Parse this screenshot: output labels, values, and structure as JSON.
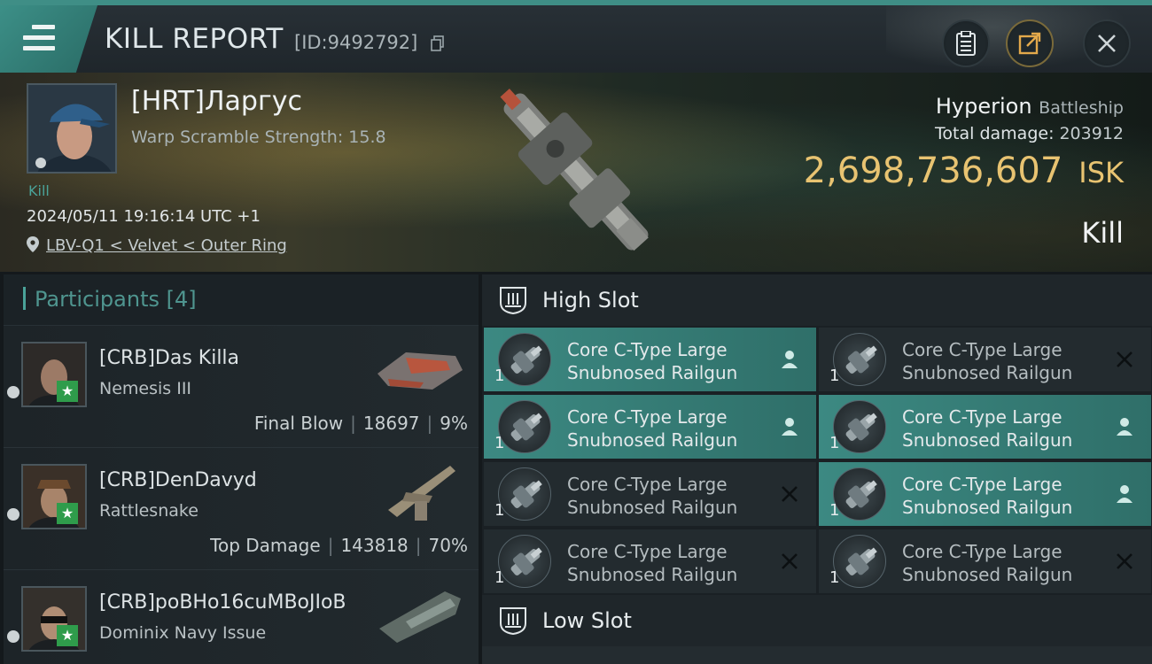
{
  "header": {
    "title": "KILL REPORT",
    "report_id": "[ID:9492792]"
  },
  "victim": {
    "name": "[HRT]Ларгус",
    "scramble": "Warp Scramble Strength: 15.8",
    "kill_tag": "Kill",
    "datetime": "2024/05/11 19:16:14 UTC +1",
    "location": "LBV-Q1 < Velvet < Outer Ring"
  },
  "summary": {
    "ship": "Hyperion",
    "ship_class": "Battleship",
    "damage_label": "Total damage:",
    "damage_value": "203912",
    "isk_value": "2,698,736,607",
    "isk_unit": "ISK",
    "result": "Kill"
  },
  "participants": {
    "label": "Participants",
    "count": "[4]",
    "rows": [
      {
        "name": "[CRB]Das Killa",
        "ship": "Nemesis III",
        "role": "Final Blow",
        "damage": "18697",
        "pct": "9%"
      },
      {
        "name": "[CRB]DenDavyd",
        "ship": "Rattlesnake",
        "role": "Top Damage",
        "damage": "143818",
        "pct": "70%"
      },
      {
        "name": "[CRB]poBHo16cuMBoJIoB",
        "ship": "Dominix Navy Issue"
      }
    ]
  },
  "slots": {
    "high_label": "High Slot",
    "low_label": "Low Slot",
    "high_modules": [
      {
        "line1": "Core C-Type Large",
        "line2": "Snubnosed Railgun",
        "qty": "1",
        "status": "dropped"
      },
      {
        "line1": "Core C-Type Large",
        "line2": "Snubnosed Railgun",
        "qty": "1",
        "status": "destroyed"
      },
      {
        "line1": "Core C-Type Large",
        "line2": "Snubnosed Railgun",
        "qty": "1",
        "status": "dropped"
      },
      {
        "line1": "Core C-Type Large",
        "line2": "Snubnosed Railgun",
        "qty": "1",
        "status": "dropped"
      },
      {
        "line1": "Core C-Type Large",
        "line2": "Snubnosed Railgun",
        "qty": "1",
        "status": "destroyed"
      },
      {
        "line1": "Core C-Type Large",
        "line2": "Snubnosed Railgun",
        "qty": "1",
        "status": "dropped"
      },
      {
        "line1": "Core C-Type Large",
        "line2": "Snubnosed Railgun",
        "qty": "1",
        "status": "destroyed"
      },
      {
        "line1": "Core C-Type Large",
        "line2": "Snubnosed Railgun",
        "qty": "1",
        "status": "destroyed"
      }
    ]
  },
  "colors": {
    "accent": "#3c8f87",
    "isk": "#e8c371",
    "dropped_bg": "#3c8982"
  }
}
